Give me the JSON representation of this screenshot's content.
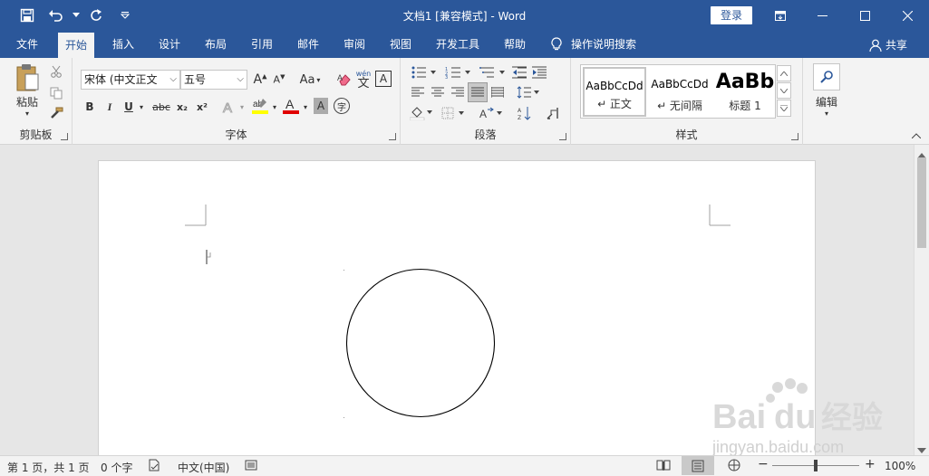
{
  "window": {
    "title": "文档1 [兼容模式] - Word",
    "login_label": "登录"
  },
  "tabs": [
    "文件",
    "开始",
    "插入",
    "设计",
    "布局",
    "引用",
    "邮件",
    "审阅",
    "视图",
    "开发工具",
    "帮助"
  ],
  "active_tab": "开始",
  "tell_me": "操作说明搜索",
  "share_label": "共享",
  "ribbon": {
    "clipboard": {
      "label": "剪贴板",
      "paste_label": "粘贴"
    },
    "font": {
      "label": "字体",
      "font_name": "宋体 (中文正文",
      "font_size": "五号",
      "bold": "B",
      "italic": "I",
      "underline": "U",
      "strike": "abc",
      "subscript": "x₂",
      "superscript": "x²",
      "phonetic": "wén",
      "phonetic_char": "文",
      "change_case": "Aa",
      "highlight_color": "#ffff00",
      "font_color": "#e00000"
    },
    "paragraph": {
      "label": "段落"
    },
    "styles": {
      "label": "样式",
      "items": [
        {
          "sample": "AaBbCcDd",
          "name": "↵ 正文"
        },
        {
          "sample": "AaBbCcDd",
          "name": "↵ 无间隔"
        },
        {
          "sample": "AaBb",
          "name": "标题 1"
        }
      ]
    },
    "editing": {
      "label": "编辑"
    }
  },
  "status": {
    "page": "第 1 页，共 1 页",
    "words": "0 个字",
    "language": "中文(中国)",
    "zoom": "100%"
  },
  "watermark": {
    "logo": "Bai du 经验",
    "url": "jingyan.baidu.com"
  },
  "colors": {
    "accent": "#2b579a"
  }
}
